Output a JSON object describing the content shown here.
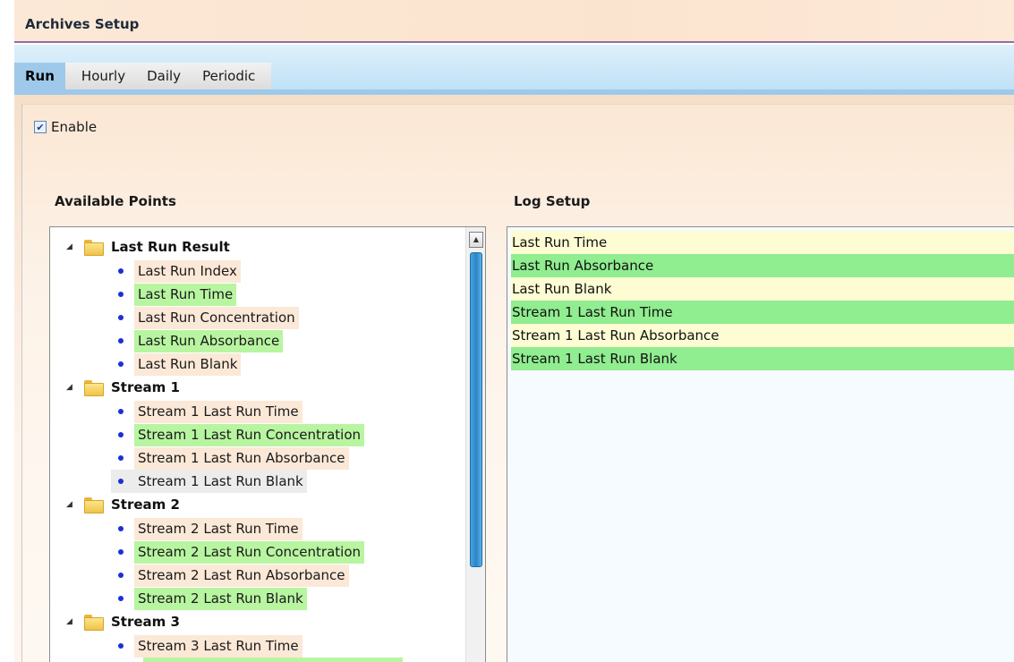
{
  "window": {
    "title": "Archives Setup"
  },
  "tabs": [
    {
      "label": "Run",
      "active": true
    },
    {
      "label": "Hourly",
      "active": false
    },
    {
      "label": "Daily",
      "active": false
    },
    {
      "label": "Periodic",
      "active": false
    }
  ],
  "enable": {
    "label": "Enable",
    "checked": true,
    "check_glyph": "✔"
  },
  "available_points": {
    "title": "Available Points",
    "groups": [
      {
        "label": "Last Run Result",
        "items": [
          "Last Run Index",
          "Last Run Time",
          "Last Run Concentration",
          "Last Run Absorbance",
          "Last Run Blank"
        ]
      },
      {
        "label": "Stream 1",
        "items": [
          "Stream 1 Last Run Time",
          "Stream 1 Last Run Concentration",
          "Stream 1 Last Run Absorbance",
          "Stream 1 Last Run Blank"
        ]
      },
      {
        "label": "Stream 2",
        "items": [
          "Stream 2 Last Run Time",
          "Stream 2 Last Run Concentration",
          "Stream 2 Last Run Absorbance",
          "Stream 2 Last Run Blank"
        ]
      },
      {
        "label": "Stream 3",
        "items": [
          "Stream 3 Last Run Time"
        ]
      }
    ],
    "expander_glyph": "◢",
    "scroll_up_glyph": "▲"
  },
  "log_setup": {
    "title": "Log Setup",
    "items": [
      "Last Run Time",
      "Last Run Absorbance",
      "Last Run Blank",
      "Stream 1 Last Run Time",
      "Stream 1 Last Run Absorbance",
      "Stream 1 Last Run Blank"
    ]
  },
  "colors": {
    "item_peach": "#fbe8d7",
    "item_green": "#b8f5a1",
    "log_yellow": "#fdfcd3",
    "log_green": "#90ed90",
    "tab_active": "#9ec9ea",
    "title_underline": "#8e6fa5"
  }
}
